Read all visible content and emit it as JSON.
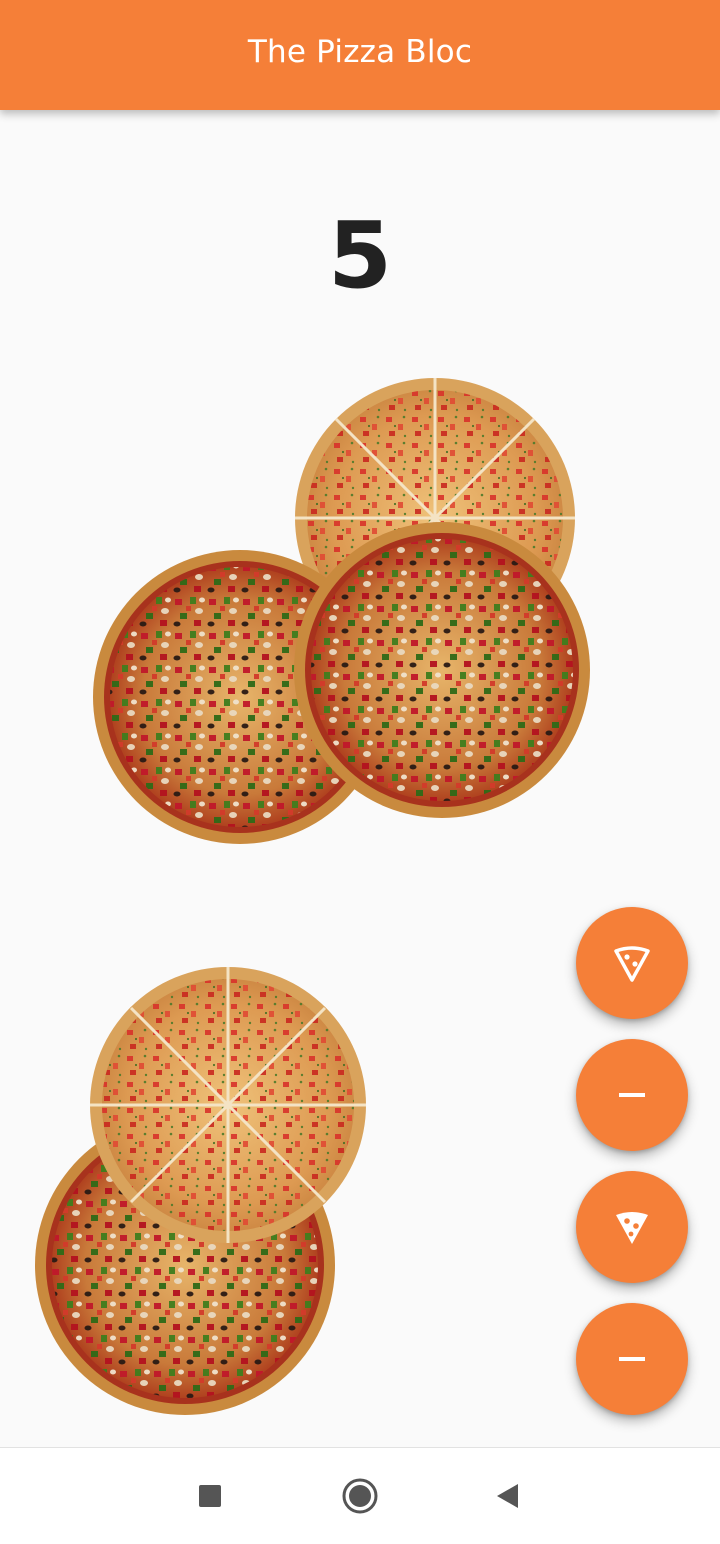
{
  "app": {
    "title": "The Pizza Bloc",
    "accent_color": "#f57f38"
  },
  "main": {
    "count": "5"
  },
  "images": {
    "pizzas_top": "two whole veggie pizzas with a sliced tomato pizza behind",
    "pizzas_bottom": "veggie pizza with a sliced tomato pizza on top"
  },
  "fabs": [
    {
      "name": "add-slice-button",
      "icon": "pizza-slice-outline-icon"
    },
    {
      "name": "remove-slice-button",
      "icon": "minus-icon"
    },
    {
      "name": "add-pizza-button",
      "icon": "pizza-slice-filled-icon"
    },
    {
      "name": "remove-pizza-button",
      "icon": "minus-icon"
    }
  ],
  "navbar": {
    "items": [
      "recents-icon",
      "home-icon",
      "back-icon"
    ]
  }
}
